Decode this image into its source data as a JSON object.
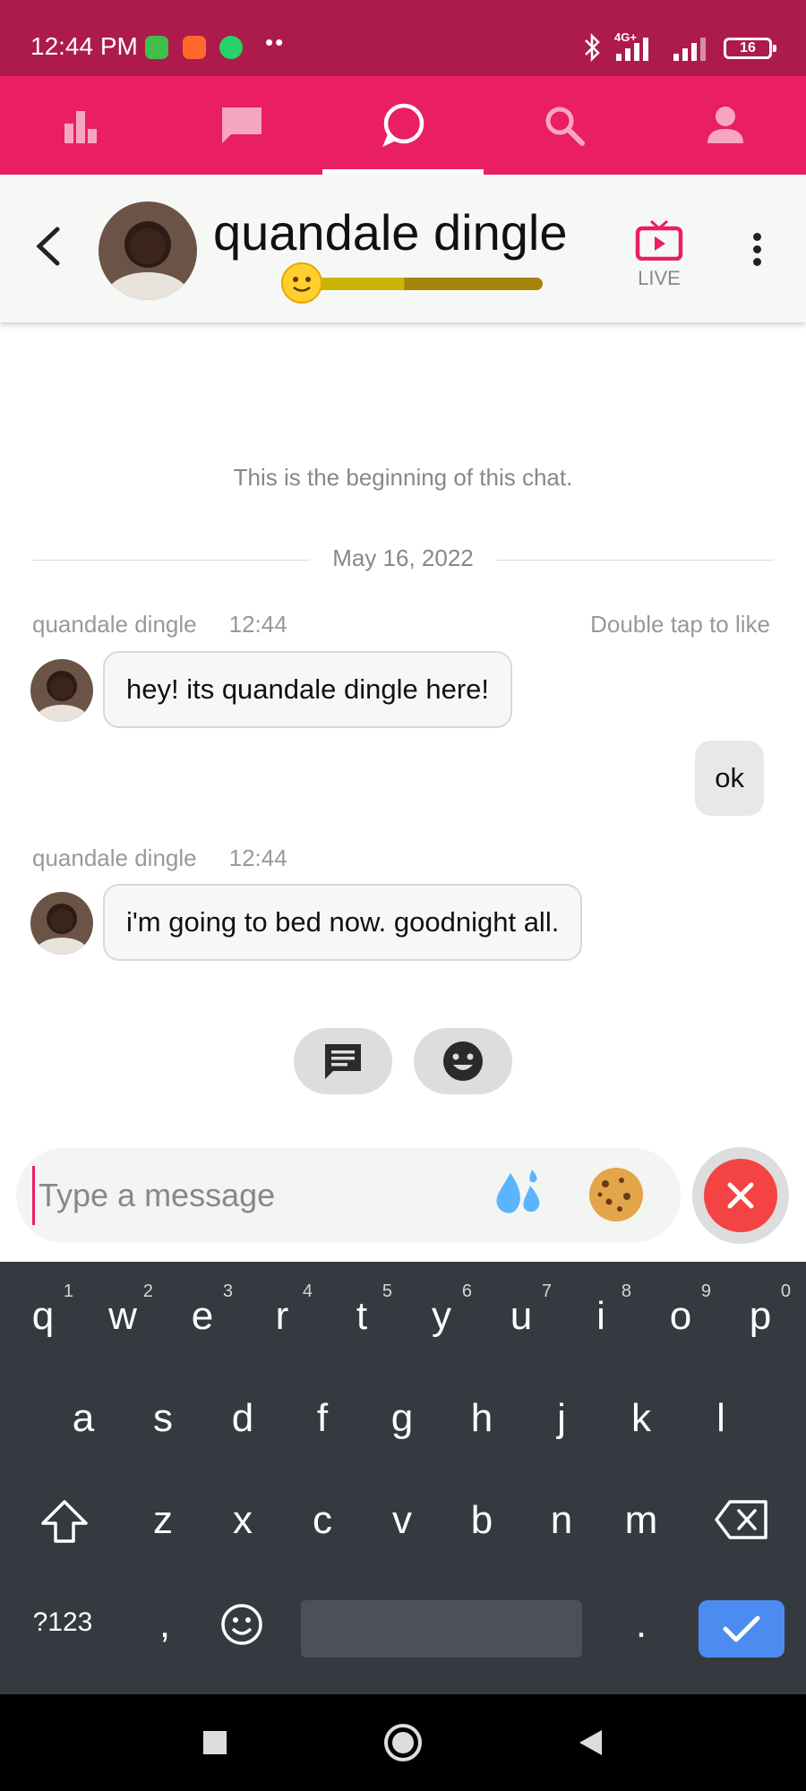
{
  "status_bar": {
    "time": "12:44 PM",
    "dots": "••",
    "network_label": "4G+",
    "battery": "16"
  },
  "top_nav": {
    "items": [
      {
        "icon": "stats-icon",
        "active": false
      },
      {
        "icon": "messages-icon",
        "active": false
      },
      {
        "icon": "chat-icon",
        "active": true
      },
      {
        "icon": "search-icon",
        "active": false
      },
      {
        "icon": "profile-icon",
        "active": false
      }
    ],
    "active_color": "#e91e63"
  },
  "chat_header": {
    "name": "quandale dingle",
    "mood_level": 0.42,
    "live_label": "LIVE"
  },
  "conversation": {
    "beginning_text": "This is the beginning of this chat.",
    "date": "May 16, 2022",
    "hint": "Double tap to like",
    "messages": [
      {
        "sender": "quandale dingle",
        "time": "12:44",
        "text": "hey! its quandale dingle here!",
        "direction": "in"
      },
      {
        "text": "ok",
        "direction": "out"
      },
      {
        "sender": "quandale dingle",
        "time": "12:44",
        "text": "i'm going to bed now. goodnight all.",
        "direction": "in"
      }
    ]
  },
  "composer": {
    "placeholder": "Type a message",
    "emoji_1": "sweat-drops-icon",
    "emoji_2": "cookie-icon"
  },
  "keyboard": {
    "row1": [
      "q",
      "w",
      "e",
      "r",
      "t",
      "y",
      "u",
      "i",
      "o",
      "p"
    ],
    "row1_hints": [
      "1",
      "2",
      "3",
      "4",
      "5",
      "6",
      "7",
      "8",
      "9",
      "0"
    ],
    "row2": [
      "a",
      "s",
      "d",
      "f",
      "g",
      "h",
      "j",
      "k",
      "l"
    ],
    "row3": [
      "z",
      "x",
      "c",
      "v",
      "b",
      "n",
      "m"
    ],
    "symbols_key": "?123",
    "comma_key": ",",
    "period_key": "."
  }
}
